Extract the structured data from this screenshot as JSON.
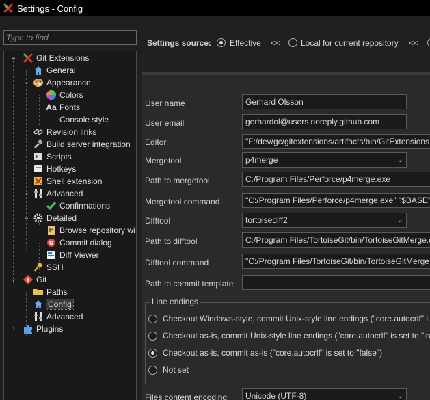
{
  "window": {
    "title": "Settings - Config"
  },
  "search": {
    "placeholder": "Type to find"
  },
  "tree": {
    "git_extensions": "Git Extensions",
    "general": "General",
    "appearance": "Appearance",
    "colors": "Colors",
    "fonts": "Fonts",
    "console_style": "Console style",
    "revision_links": "Revision links",
    "build_server": "Build server integration",
    "scripts": "Scripts",
    "hotkeys": "Hotkeys",
    "shell_extension": "Shell extension",
    "advanced": "Advanced",
    "confirmations": "Confirmations",
    "detailed": "Detailed",
    "browse_repo": "Browse repository wi",
    "commit_dialog": "Commit dialog",
    "diff_viewer": "Diff Viewer",
    "ssh": "SSH",
    "git": "Git",
    "paths": "Paths",
    "config": "Config",
    "git_advanced": "Advanced",
    "plugins": "Plugins"
  },
  "source": {
    "label": "Settings source:",
    "effective": "Effective",
    "arrows1": "<<",
    "local": "Local for current repository",
    "arrows2": "<<",
    "selected": "Effective"
  },
  "form": {
    "user_name_label": "User name",
    "user_name": "Gerhard Olsson",
    "user_email_label": "User email",
    "user_email": "gerhardol@users.noreply.github.com",
    "editor_label": "Editor",
    "editor": "\"F:/dev/gc/gitextensions/artifacts/bin/GitExtensions",
    "mergetool_label": "Mergetool",
    "mergetool": "p4merge",
    "path_mergetool_label": "Path to mergetool",
    "path_mergetool": "C:/Program Files/Perforce/p4merge.exe",
    "mergetool_cmd_label": "Mergetool command",
    "mergetool_cmd": "\"C:/Program Files/Perforce/p4merge.exe\" \"$BASE\" \"",
    "difftool_label": "Difftool",
    "difftool": "tortoisediff2",
    "path_difftool_label": "Path to difftool",
    "path_difftool": "C:/Program Files/TortoiseGit/bin/TortoiseGitMerge.e",
    "difftool_cmd_label": "Difftool command",
    "difftool_cmd": "\"C:/Program Files/TortoiseGit/bin/TortoiseGitMerge",
    "commit_template_label": "Path to commit template",
    "commit_template": "",
    "encoding_label": "Files content encoding",
    "encoding": "Unicode (UTF-8)"
  },
  "line_endings": {
    "title": "Line endings",
    "opt1": "Checkout Windows-style, commit Unix-style line endings (\"core.autocrlf\"  i",
    "opt2": "Checkout as-is, commit Unix-style line endings (\"core.autocrlf\"  is set to \"in",
    "opt3": "Checkout as-is, commit as-is (\"core.autocrlf\"  is set to \"false\")",
    "opt4": "Not set",
    "selected": "opt3"
  },
  "colors": {
    "background": "#202020",
    "panel": "#2a2a2a",
    "tree": "#191919",
    "git_extensions_icon": "#e0302a"
  },
  "icons": [
    "git-extensions-icon",
    "home-icon",
    "palette-icon",
    "color-wheel-icon",
    "fonts-icon",
    "console-icon",
    "link-icon",
    "build-icon",
    "scripts-icon",
    "hotkeys-icon",
    "shell-icon",
    "advanced-icon",
    "check-icon",
    "gear-icon",
    "browse-icon",
    "commit-icon",
    "diff-icon",
    "key-icon",
    "git-icon",
    "folder-icon",
    "puzzle-icon"
  ]
}
